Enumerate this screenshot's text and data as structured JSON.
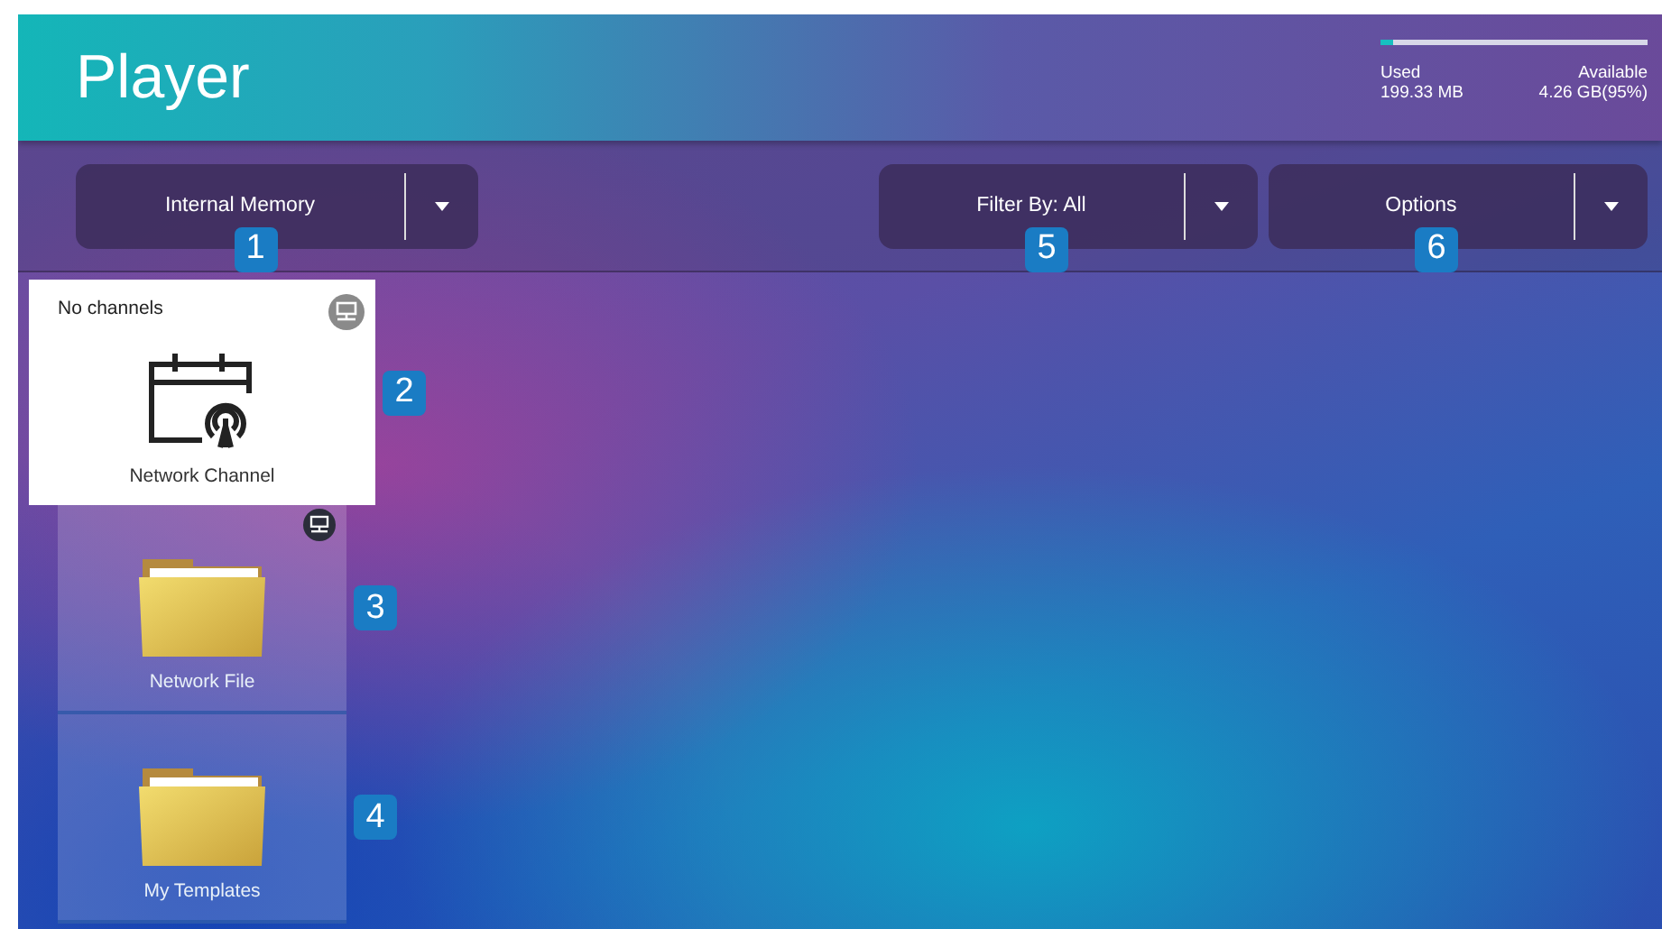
{
  "header": {
    "title": "Player",
    "storage": {
      "level": 0.05,
      "used_label": "Used",
      "used_value": "199.33 MB",
      "available_label": "Available",
      "available_value": "4.26 GB(95%)"
    }
  },
  "toolbar": {
    "dropdowns": [
      {
        "label": "Internal Memory",
        "callout": "1"
      },
      {
        "label": "Filter By: All",
        "callout": "5"
      },
      {
        "label": "Options",
        "callout": "6"
      }
    ]
  },
  "items": [
    {
      "kind": "channel",
      "label": "Network Channel",
      "status": "No channels",
      "selected": true,
      "network": true,
      "callout": "2"
    },
    {
      "kind": "folder",
      "label": "Network File",
      "selected": false,
      "network": true,
      "callout": "3"
    },
    {
      "kind": "folder",
      "label": "My Templates",
      "selected": false,
      "network": false,
      "callout": "4"
    }
  ]
}
